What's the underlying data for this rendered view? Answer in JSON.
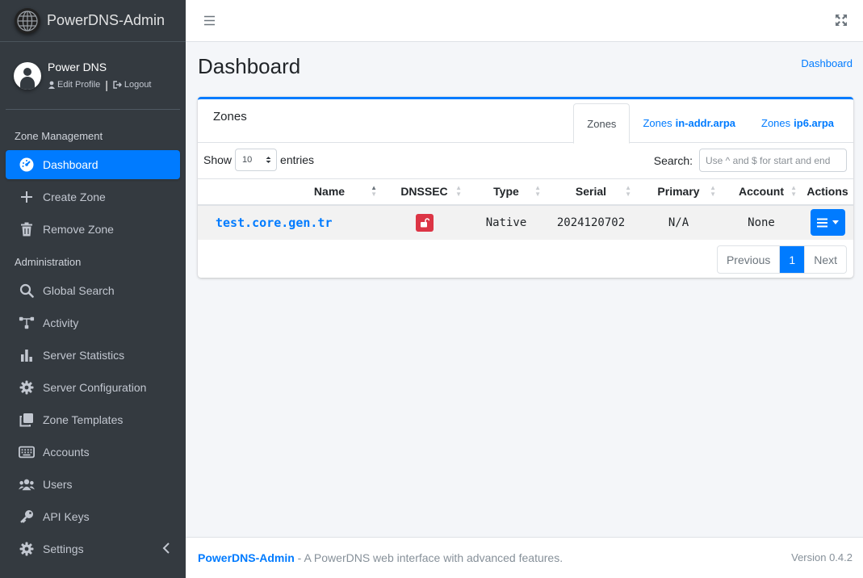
{
  "brand": {
    "title": "PowerDNS-Admin"
  },
  "user": {
    "name": "Power DNS",
    "edit_profile": "Edit Profile",
    "logout": "Logout"
  },
  "sidebar": {
    "sections": [
      {
        "header": "Zone Management"
      },
      {
        "header": "Administration"
      }
    ],
    "items": [
      {
        "label": "Dashboard",
        "icon": "dashboard-icon"
      },
      {
        "label": "Create Zone",
        "icon": "plus-icon"
      },
      {
        "label": "Remove Zone",
        "icon": "trash-icon"
      },
      {
        "label": "Global Search",
        "icon": "search-icon"
      },
      {
        "label": "Activity",
        "icon": "activity-icon"
      },
      {
        "label": "Server Statistics",
        "icon": "bar-chart-icon"
      },
      {
        "label": "Server Configuration",
        "icon": "gear-icon"
      },
      {
        "label": "Zone Templates",
        "icon": "clone-icon"
      },
      {
        "label": "Accounts",
        "icon": "keyboard-icon"
      },
      {
        "label": "Users",
        "icon": "users-icon"
      },
      {
        "label": "API Keys",
        "icon": "key-icon"
      },
      {
        "label": "Settings",
        "icon": "gear-icon"
      }
    ]
  },
  "page": {
    "title": "Dashboard",
    "breadcrumb": "Dashboard"
  },
  "card": {
    "title": "Zones",
    "tabs": [
      {
        "prefix": "Zones",
        "suffix": ""
      },
      {
        "prefix": "Zones",
        "suffix": "in-addr.arpa"
      },
      {
        "prefix": "Zones",
        "suffix": "ip6.arpa"
      }
    ],
    "show_label": "Show",
    "entries_value": "10",
    "entries_label": "entries",
    "search_label": "Search:",
    "search_placeholder": "Use ^ and $ for start and end"
  },
  "table": {
    "columns": [
      "Name",
      "DNSSEC",
      "Type",
      "Serial",
      "Primary",
      "Account",
      "Actions"
    ],
    "rows": [
      {
        "name": "test.core.gen.tr",
        "type": "Native",
        "serial": "2024120702",
        "primary": "N/A",
        "account": "None"
      }
    ]
  },
  "pagination": {
    "previous": "Previous",
    "page": "1",
    "next": "Next"
  },
  "footer": {
    "brand": "PowerDNS-Admin",
    "tagline": " - A PowerDNS web interface with advanced features.",
    "version": "Version 0.4.2"
  },
  "colors": {
    "accent": "#007bff",
    "sidebar": "#343a40",
    "danger": "#dc3545"
  }
}
